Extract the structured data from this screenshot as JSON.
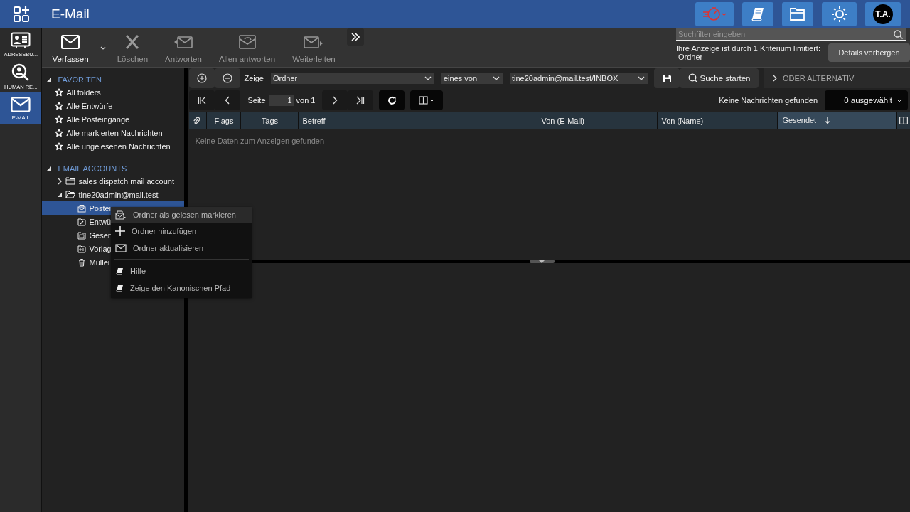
{
  "app": {
    "title": "E-Mail"
  },
  "header_buttons": [
    {
      "kind": "timer"
    },
    {
      "kind": "help"
    },
    {
      "kind": "files"
    },
    {
      "kind": "theme"
    }
  ],
  "user": {
    "initials": "T.A."
  },
  "rail": [
    {
      "label": "ADRESSBU...",
      "kind": "contacts",
      "selected": false
    },
    {
      "label": "HUMAN RE...",
      "kind": "hr",
      "selected": false
    },
    {
      "label": "E-MAIL",
      "kind": "mail",
      "selected": true
    }
  ],
  "toolbar": [
    {
      "label": "Verfassen",
      "kind": "compose",
      "disabled": false,
      "dropdown": true
    },
    {
      "label": "Löschen",
      "kind": "delete",
      "disabled": true,
      "dropdown": false
    },
    {
      "label": "Antworten",
      "kind": "reply",
      "disabled": true,
      "dropdown": false
    },
    {
      "label": "Allen antworten",
      "kind": "reply-all",
      "disabled": true,
      "dropdown": false
    },
    {
      "label": "Weiterleiten",
      "kind": "forward",
      "disabled": true,
      "dropdown": false
    }
  ],
  "search": {
    "placeholder": "Suchfilter eingeben"
  },
  "filter_notice": {
    "text": "Ihre Anzeige ist durch 1 Kriterium limitiert:",
    "detail": "Ordner",
    "button": "Details verbergen"
  },
  "tree": [
    {
      "label": "FAVORITEN",
      "expanded": true,
      "items": [
        {
          "label": "All folders",
          "kind": "favorite"
        },
        {
          "label": "Alle Entwürfe",
          "kind": "favorite"
        },
        {
          "label": "Alle Posteingänge",
          "kind": "favorite"
        },
        {
          "label": "Alle markierten Nachrichten",
          "kind": "favorite"
        },
        {
          "label": "Alle ungelesenen Nachrichten",
          "kind": "favorite"
        }
      ]
    },
    {
      "label": "EMAIL ACCOUNTS",
      "expanded": true,
      "items": [
        {
          "label": "sales dispatch mail account",
          "kind": "account",
          "expanded": false
        },
        {
          "label": "tine20admin@mail.test",
          "kind": "account",
          "expanded": true,
          "children": [
            {
              "label": "Postei",
              "kind": "inbox",
              "selected": true
            },
            {
              "label": "Entwü",
              "kind": "drafts",
              "selected": false
            },
            {
              "label": "Gesen",
              "kind": "sent",
              "selected": false
            },
            {
              "label": "Vorlag",
              "kind": "templates",
              "selected": false
            },
            {
              "label": "Müllei",
              "kind": "trash",
              "selected": false
            }
          ]
        }
      ]
    }
  ],
  "filter": {
    "show_label": "Zeige",
    "field": "Ordner",
    "operator": "eines von",
    "value": "tine20admin@mail.test/INBOX",
    "search_button": "Suche starten",
    "alternative": "ODER ALTERNATIV"
  },
  "pager": {
    "page_label": "Seite",
    "page": "1",
    "of_label": "von 1",
    "status": "Keine Nachrichten gefunden",
    "selection": "0 ausgewählt"
  },
  "columns": [
    {
      "kind": "attachment",
      "sorted": false
    },
    {
      "label": "Flags",
      "kind": "text",
      "sorted": false
    },
    {
      "label": "Tags",
      "kind": "text",
      "sorted": false
    },
    {
      "label": "Betreff",
      "kind": "text",
      "sorted": false
    },
    {
      "label": "Von (E-Mail)",
      "kind": "text",
      "sorted": false
    },
    {
      "label": "Von (Name)",
      "kind": "text",
      "sorted": false
    },
    {
      "label": "Gesendet",
      "kind": "text",
      "sorted": true
    }
  ],
  "empty_message": "Keine Daten zum Anzeigen gefunden",
  "context_menu": [
    {
      "label": "Ordner als gelesen markieren",
      "kind": "mark-read",
      "selected": true,
      "separator_before": false
    },
    {
      "label": "Ordner hinzufügen",
      "kind": "add",
      "selected": false,
      "separator_before": false
    },
    {
      "label": "Ordner aktualisieren",
      "kind": "refresh",
      "selected": false,
      "separator_before": false
    },
    {
      "label": "Hilfe",
      "kind": "help",
      "selected": false,
      "separator_before": true
    },
    {
      "label": "Zeige den Kanonischen Pfad",
      "kind": "help",
      "selected": false,
      "separator_before": false
    }
  ]
}
